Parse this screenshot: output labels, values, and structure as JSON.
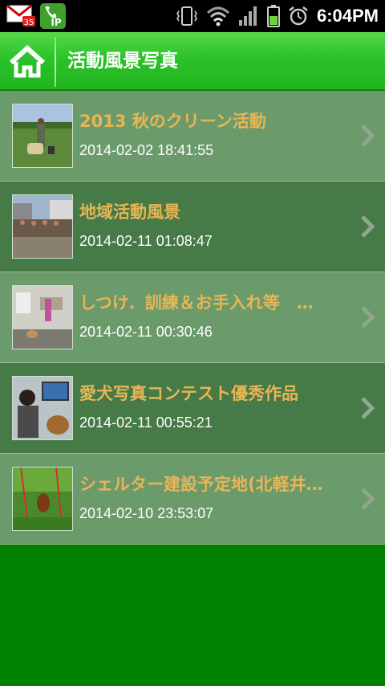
{
  "status_bar": {
    "time": "6:04PM",
    "mail_badge": "35",
    "ip_label": "IP"
  },
  "header": {
    "title": "活動風景写真",
    "home_icon": "home-icon"
  },
  "items": [
    {
      "title": "2013 秋のクリーン活動",
      "date": "2014-02-02 18:41:55"
    },
    {
      "title": "地域活動風景",
      "date": "2014-02-11 01:08:47"
    },
    {
      "title": "しつけ．訓練＆お手入れ等　…",
      "date": "2014-02-11 00:30:46"
    },
    {
      "title": "愛犬写真コンテスト優秀作品",
      "date": "2014-02-11 00:55:21"
    },
    {
      "title": "シェルター建設予定地(北軽井…",
      "date": "2014-02-10 23:53:07"
    }
  ],
  "colors": {
    "header_green": "#2cc22a",
    "row_light": "#6b9a6b",
    "row_dark": "#467a46",
    "title_orange": "#e8b556",
    "background": "#008000"
  }
}
